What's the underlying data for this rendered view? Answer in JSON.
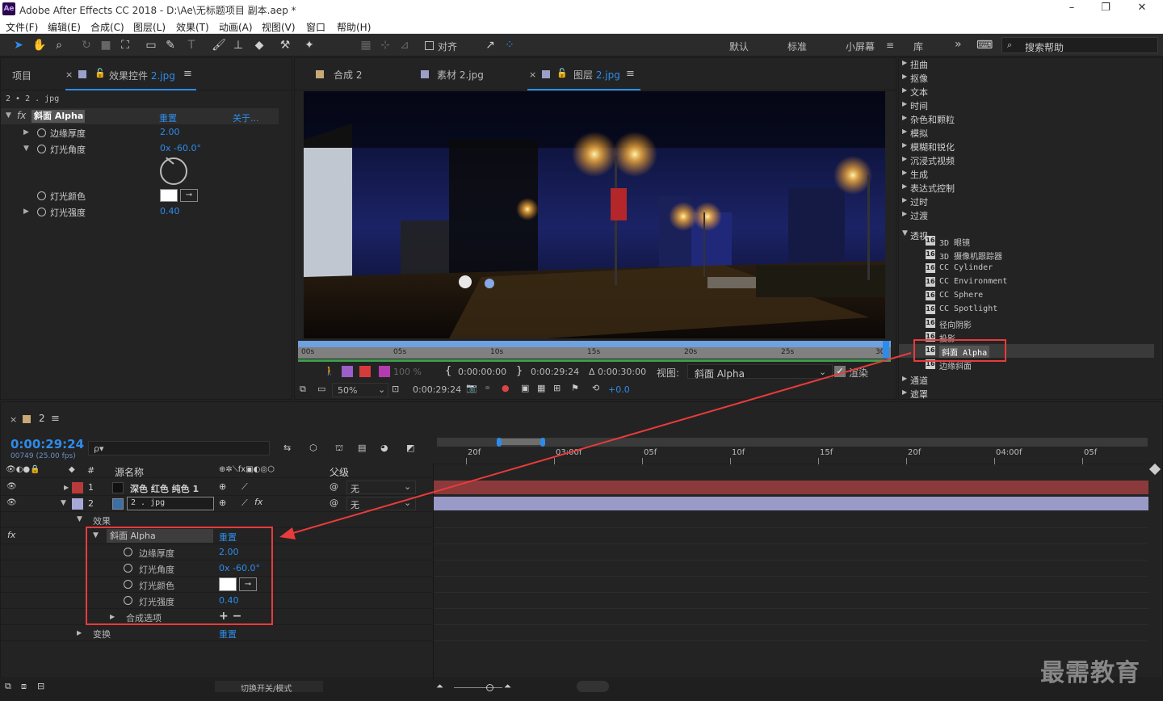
{
  "window": {
    "logo": "Ae",
    "title": "Adobe After Effects CC 2018 - D:\\Ae\\无标题项目 副本.aep *",
    "controls": [
      "–",
      "❐",
      "✕"
    ]
  },
  "menu": [
    "文件(F)",
    "编辑(E)",
    "合成(C)",
    "图层(L)",
    "效果(T)",
    "动画(A)",
    "视图(V)",
    "窗口",
    "帮助(H)"
  ],
  "toolbar": {
    "snap_label": "对齐",
    "workspaces": [
      "默认",
      "标准",
      "小屏幕",
      "库"
    ],
    "active_workspace": "小屏幕",
    "more": "»",
    "search_placeholder": "搜索帮助"
  },
  "left_panel": {
    "tab_project": "项目",
    "tab_effects_prefix": "效果控件",
    "tab_effects_file": "2.jpg",
    "breadcrumb": "2 • 2 . jpg",
    "effect_name": "斜面 Alpha",
    "reset": "重置",
    "about": "关于...",
    "props": [
      {
        "label": "边缘厚度",
        "value": "2.00"
      },
      {
        "label": "灯光角度",
        "value": "0x -60.0°"
      },
      {
        "label": "灯光颜色",
        "value": ""
      },
      {
        "label": "灯光强度",
        "value": "0.40"
      }
    ]
  },
  "viewer": {
    "tabs": [
      "合成 2",
      "素材 2.jpg",
      "图层 2.jpg"
    ],
    "tab_layer_prefix": "图层",
    "tab_layer_file": "2.jpg",
    "ruler": [
      "00s",
      "05s",
      "10s",
      "15s",
      "20s",
      "25s",
      "30s"
    ],
    "opacity": "100 %",
    "in_time": "0:00:00:00",
    "out_time": "0:00:29:24",
    "duration": "Δ 0:00:30:00",
    "view_label": "视图:",
    "view_value": "斜面 Alpha",
    "render_label": "渲染",
    "zoom": "50%",
    "current_time": "0:00:29:24",
    "exposure": "+0.0"
  },
  "effects_list": {
    "categories_top": [
      "扭曲",
      "抠像",
      "文本",
      "时间",
      "杂色和颗粒",
      "模拟",
      "模糊和锐化",
      "沉浸式视频",
      "生成",
      "表达式控制",
      "过时",
      "过渡"
    ],
    "expanded": "透视",
    "items": [
      "3D 眼镜",
      "3D 摄像机跟踪器",
      "CC Cylinder",
      "CC Environment",
      "CC Sphere",
      "CC Spotlight",
      "径向阴影",
      "投影",
      "斜面 Alpha",
      "边缘斜面"
    ],
    "selected": "斜面 Alpha",
    "categories_bottom": [
      "通道",
      "遮罩"
    ]
  },
  "timeline": {
    "comp_name": "2",
    "timecode": "0:00:29:24",
    "frames": "00749 (25.00 fps)",
    "search_placeholder": "ρ▾",
    "col_source": "源名称",
    "col_parent": "父级",
    "col_num": "#",
    "ruler": [
      "20f",
      "03:00f",
      "05f",
      "10f",
      "15f",
      "20f",
      "04:00f",
      "05f"
    ],
    "layers": [
      {
        "num": "1",
        "name": "深色 红色 纯色 1",
        "parent": "无",
        "color": "#b83a3a"
      },
      {
        "num": "2",
        "name": "2 . jpg",
        "parent": "无",
        "color": "#a8a8d8"
      }
    ],
    "effects_group": "效果",
    "effect_name": "斜面 Alpha",
    "reset": "重置",
    "props": [
      {
        "label": "边缘厚度",
        "value": "2.00"
      },
      {
        "label": "灯光角度",
        "value": "0x -60.0°"
      },
      {
        "label": "灯光颜色",
        "value": ""
      },
      {
        "label": "灯光强度",
        "value": "0.40"
      }
    ],
    "composite_options": "合成选项",
    "composite_value": "+ −",
    "transform": "变换",
    "transform_reset": "重置",
    "toggle_label": "切换开关/模式"
  },
  "watermark": "最需教育",
  "colors": {
    "accent": "#2d8ceb",
    "highlight": "#e83b3b",
    "layer1": "#b83a3a",
    "layer2": "#a8a8d8"
  }
}
